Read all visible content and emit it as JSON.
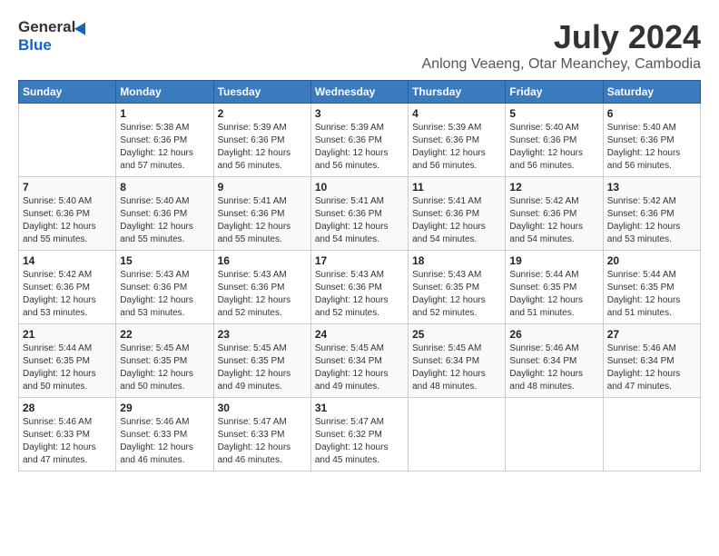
{
  "logo": {
    "general": "General",
    "blue": "Blue"
  },
  "title": {
    "month_year": "July 2024",
    "location": "Anlong Veaeng, Otar Meanchey, Cambodia"
  },
  "weekdays": [
    "Sunday",
    "Monday",
    "Tuesday",
    "Wednesday",
    "Thursday",
    "Friday",
    "Saturday"
  ],
  "weeks": [
    [
      {
        "day": "",
        "sunrise": "",
        "sunset": "",
        "daylight": ""
      },
      {
        "day": "1",
        "sunrise": "Sunrise: 5:38 AM",
        "sunset": "Sunset: 6:36 PM",
        "daylight": "Daylight: 12 hours and 57 minutes."
      },
      {
        "day": "2",
        "sunrise": "Sunrise: 5:39 AM",
        "sunset": "Sunset: 6:36 PM",
        "daylight": "Daylight: 12 hours and 56 minutes."
      },
      {
        "day": "3",
        "sunrise": "Sunrise: 5:39 AM",
        "sunset": "Sunset: 6:36 PM",
        "daylight": "Daylight: 12 hours and 56 minutes."
      },
      {
        "day": "4",
        "sunrise": "Sunrise: 5:39 AM",
        "sunset": "Sunset: 6:36 PM",
        "daylight": "Daylight: 12 hours and 56 minutes."
      },
      {
        "day": "5",
        "sunrise": "Sunrise: 5:40 AM",
        "sunset": "Sunset: 6:36 PM",
        "daylight": "Daylight: 12 hours and 56 minutes."
      },
      {
        "day": "6",
        "sunrise": "Sunrise: 5:40 AM",
        "sunset": "Sunset: 6:36 PM",
        "daylight": "Daylight: 12 hours and 56 minutes."
      }
    ],
    [
      {
        "day": "7",
        "sunrise": "Sunrise: 5:40 AM",
        "sunset": "Sunset: 6:36 PM",
        "daylight": "Daylight: 12 hours and 55 minutes."
      },
      {
        "day": "8",
        "sunrise": "Sunrise: 5:40 AM",
        "sunset": "Sunset: 6:36 PM",
        "daylight": "Daylight: 12 hours and 55 minutes."
      },
      {
        "day": "9",
        "sunrise": "Sunrise: 5:41 AM",
        "sunset": "Sunset: 6:36 PM",
        "daylight": "Daylight: 12 hours and 55 minutes."
      },
      {
        "day": "10",
        "sunrise": "Sunrise: 5:41 AM",
        "sunset": "Sunset: 6:36 PM",
        "daylight": "Daylight: 12 hours and 54 minutes."
      },
      {
        "day": "11",
        "sunrise": "Sunrise: 5:41 AM",
        "sunset": "Sunset: 6:36 PM",
        "daylight": "Daylight: 12 hours and 54 minutes."
      },
      {
        "day": "12",
        "sunrise": "Sunrise: 5:42 AM",
        "sunset": "Sunset: 6:36 PM",
        "daylight": "Daylight: 12 hours and 54 minutes."
      },
      {
        "day": "13",
        "sunrise": "Sunrise: 5:42 AM",
        "sunset": "Sunset: 6:36 PM",
        "daylight": "Daylight: 12 hours and 53 minutes."
      }
    ],
    [
      {
        "day": "14",
        "sunrise": "Sunrise: 5:42 AM",
        "sunset": "Sunset: 6:36 PM",
        "daylight": "Daylight: 12 hours and 53 minutes."
      },
      {
        "day": "15",
        "sunrise": "Sunrise: 5:43 AM",
        "sunset": "Sunset: 6:36 PM",
        "daylight": "Daylight: 12 hours and 53 minutes."
      },
      {
        "day": "16",
        "sunrise": "Sunrise: 5:43 AM",
        "sunset": "Sunset: 6:36 PM",
        "daylight": "Daylight: 12 hours and 52 minutes."
      },
      {
        "day": "17",
        "sunrise": "Sunrise: 5:43 AM",
        "sunset": "Sunset: 6:36 PM",
        "daylight": "Daylight: 12 hours and 52 minutes."
      },
      {
        "day": "18",
        "sunrise": "Sunrise: 5:43 AM",
        "sunset": "Sunset: 6:35 PM",
        "daylight": "Daylight: 12 hours and 52 minutes."
      },
      {
        "day": "19",
        "sunrise": "Sunrise: 5:44 AM",
        "sunset": "Sunset: 6:35 PM",
        "daylight": "Daylight: 12 hours and 51 minutes."
      },
      {
        "day": "20",
        "sunrise": "Sunrise: 5:44 AM",
        "sunset": "Sunset: 6:35 PM",
        "daylight": "Daylight: 12 hours and 51 minutes."
      }
    ],
    [
      {
        "day": "21",
        "sunrise": "Sunrise: 5:44 AM",
        "sunset": "Sunset: 6:35 PM",
        "daylight": "Daylight: 12 hours and 50 minutes."
      },
      {
        "day": "22",
        "sunrise": "Sunrise: 5:45 AM",
        "sunset": "Sunset: 6:35 PM",
        "daylight": "Daylight: 12 hours and 50 minutes."
      },
      {
        "day": "23",
        "sunrise": "Sunrise: 5:45 AM",
        "sunset": "Sunset: 6:35 PM",
        "daylight": "Daylight: 12 hours and 49 minutes."
      },
      {
        "day": "24",
        "sunrise": "Sunrise: 5:45 AM",
        "sunset": "Sunset: 6:34 PM",
        "daylight": "Daylight: 12 hours and 49 minutes."
      },
      {
        "day": "25",
        "sunrise": "Sunrise: 5:45 AM",
        "sunset": "Sunset: 6:34 PM",
        "daylight": "Daylight: 12 hours and 48 minutes."
      },
      {
        "day": "26",
        "sunrise": "Sunrise: 5:46 AM",
        "sunset": "Sunset: 6:34 PM",
        "daylight": "Daylight: 12 hours and 48 minutes."
      },
      {
        "day": "27",
        "sunrise": "Sunrise: 5:46 AM",
        "sunset": "Sunset: 6:34 PM",
        "daylight": "Daylight: 12 hours and 47 minutes."
      }
    ],
    [
      {
        "day": "28",
        "sunrise": "Sunrise: 5:46 AM",
        "sunset": "Sunset: 6:33 PM",
        "daylight": "Daylight: 12 hours and 47 minutes."
      },
      {
        "day": "29",
        "sunrise": "Sunrise: 5:46 AM",
        "sunset": "Sunset: 6:33 PM",
        "daylight": "Daylight: 12 hours and 46 minutes."
      },
      {
        "day": "30",
        "sunrise": "Sunrise: 5:47 AM",
        "sunset": "Sunset: 6:33 PM",
        "daylight": "Daylight: 12 hours and 46 minutes."
      },
      {
        "day": "31",
        "sunrise": "Sunrise: 5:47 AM",
        "sunset": "Sunset: 6:32 PM",
        "daylight": "Daylight: 12 hours and 45 minutes."
      },
      {
        "day": "",
        "sunrise": "",
        "sunset": "",
        "daylight": ""
      },
      {
        "day": "",
        "sunrise": "",
        "sunset": "",
        "daylight": ""
      },
      {
        "day": "",
        "sunrise": "",
        "sunset": "",
        "daylight": ""
      }
    ]
  ]
}
